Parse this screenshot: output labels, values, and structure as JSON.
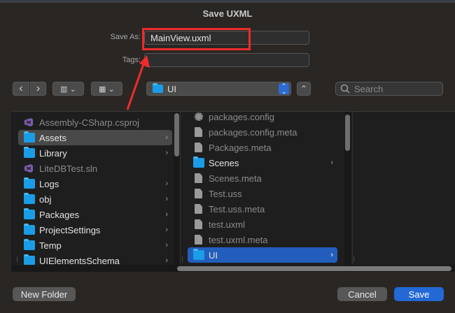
{
  "dialog": {
    "title": "Save UXML"
  },
  "form": {
    "save_as_label": "Save As:",
    "filename": "MainView.uxml",
    "tags_label": "Tags:",
    "tags_value": ""
  },
  "toolbar": {
    "back_label": "‹",
    "forward_label": "›",
    "view_columns_label": "▥ ⌄",
    "view_grid_label": "▦ ⌄",
    "location": "UI",
    "expand_label": "⌃",
    "search_placeholder": "Search"
  },
  "column1": [
    {
      "label": "Assembly-CSharp.csproj",
      "icon": "vs-project-icon",
      "dim": true,
      "folder": false
    },
    {
      "label": "Assets",
      "icon": "folder-icon",
      "selected": true,
      "folder": true
    },
    {
      "label": "Library",
      "icon": "folder-icon",
      "folder": true
    },
    {
      "label": "LiteDBTest.sln",
      "icon": "vs-solution-icon",
      "dim": true,
      "folder": false
    },
    {
      "label": "Logs",
      "icon": "folder-icon",
      "folder": true
    },
    {
      "label": "obj",
      "icon": "folder-icon",
      "folder": true
    },
    {
      "label": "Packages",
      "icon": "folder-icon",
      "folder": true
    },
    {
      "label": "ProjectSettings",
      "icon": "folder-icon",
      "folder": true
    },
    {
      "label": "Temp",
      "icon": "folder-icon",
      "folder": true
    },
    {
      "label": "UIElementsSchema",
      "icon": "folder-icon",
      "folder": true
    }
  ],
  "column2": [
    {
      "label": "packages.config",
      "icon": "config-file-icon",
      "dim": true,
      "folder": false
    },
    {
      "label": "packages.config.meta",
      "icon": "document-icon",
      "dim": true,
      "folder": false
    },
    {
      "label": "Packages.meta",
      "icon": "document-icon",
      "dim": true,
      "folder": false
    },
    {
      "label": "Scenes",
      "icon": "folder-icon",
      "folder": true
    },
    {
      "label": "Scenes.meta",
      "icon": "document-icon",
      "dim": true,
      "folder": false
    },
    {
      "label": "Test.uss",
      "icon": "document-icon",
      "dim": true,
      "folder": false
    },
    {
      "label": "Test.uss.meta",
      "icon": "document-icon",
      "dim": true,
      "folder": false
    },
    {
      "label": "test.uxml",
      "icon": "document-icon",
      "dim": true,
      "folder": false
    },
    {
      "label": "test.uxml.meta",
      "icon": "document-icon",
      "dim": true,
      "folder": false
    },
    {
      "label": "UI",
      "icon": "folder-icon",
      "selected": true,
      "folder": true
    }
  ],
  "buttons": {
    "new_folder": "New Folder",
    "cancel": "Cancel",
    "save": "Save"
  },
  "colors": {
    "accent": "#2468d6",
    "annotation": "#ef2b2b",
    "folder": "#1a9de6"
  }
}
